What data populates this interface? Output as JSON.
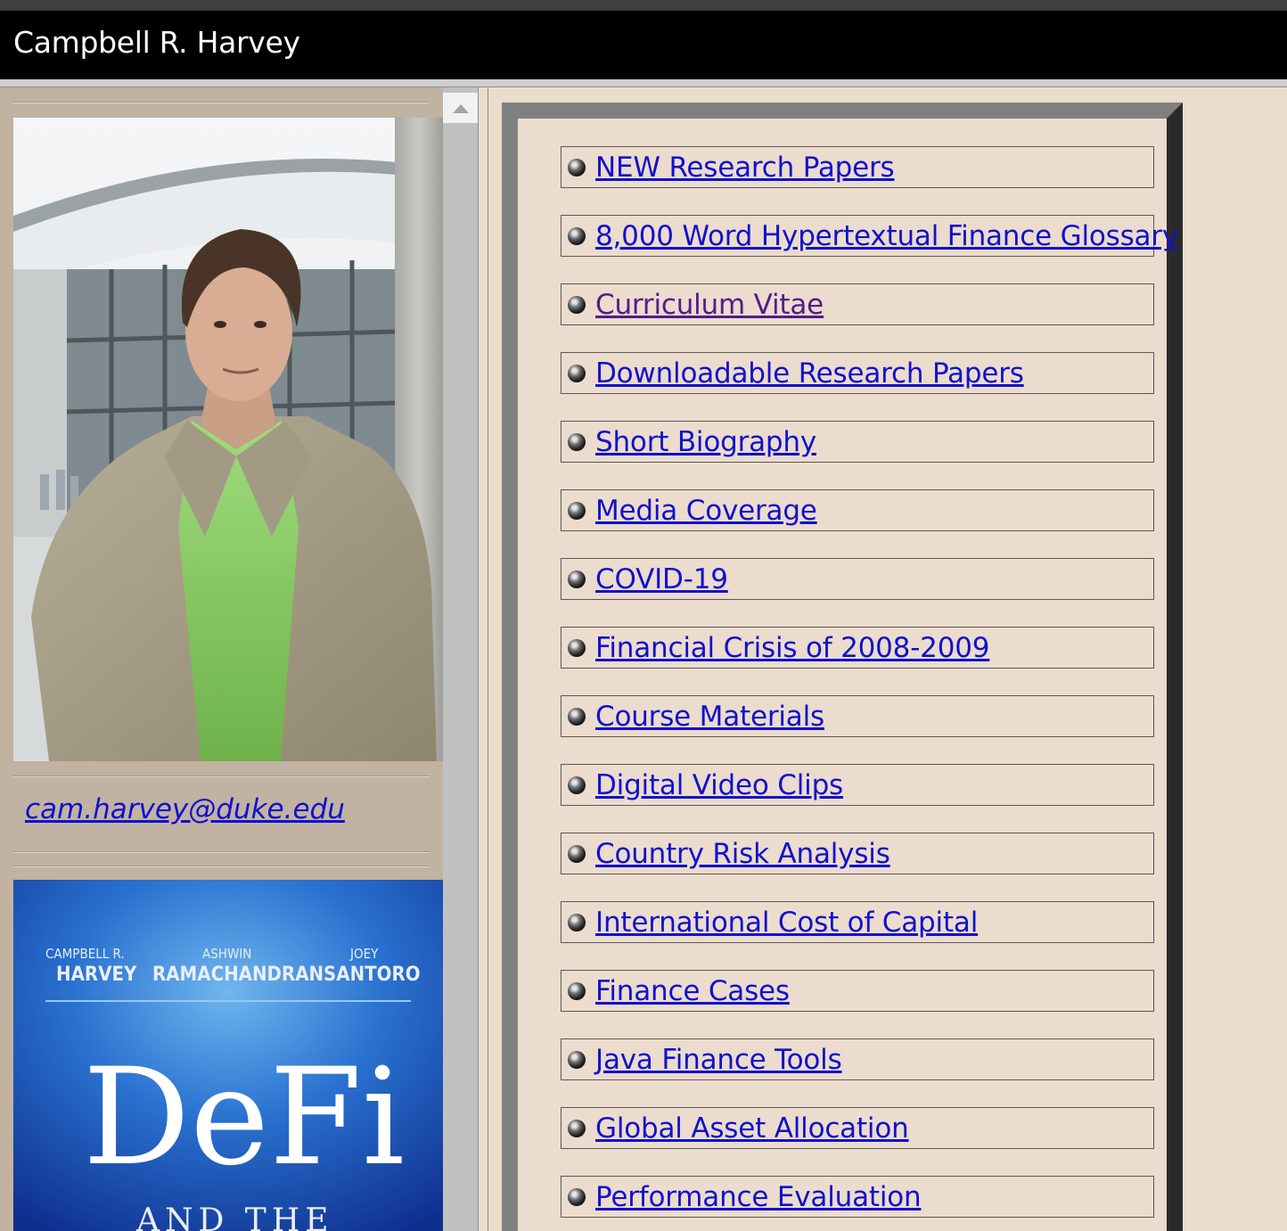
{
  "header": {
    "title": "Campbell R. Harvey"
  },
  "sidebar": {
    "photo_alt": "Portrait photo",
    "email": "cam.harvey@duke.edu",
    "book": {
      "authors": [
        {
          "first": "CAMPBELL R.",
          "last": "HARVEY"
        },
        {
          "first": "ASHWIN",
          "last": "RAMACHANDRAN"
        },
        {
          "first": "JOEY",
          "last": "SANTORO"
        }
      ],
      "title": "DeFi",
      "subtitle_fragment": "AND THE"
    }
  },
  "nav": {
    "links": [
      {
        "label": "NEW Research Papers",
        "visited": false
      },
      {
        "label": "8,000 Word Hypertextual Finance Glossary",
        "visited": false
      },
      {
        "label": "Curriculum Vitae",
        "visited": true
      },
      {
        "label": "Downloadable Research Papers",
        "visited": false
      },
      {
        "label": "Short Biography",
        "visited": false
      },
      {
        "label": "Media Coverage",
        "visited": false
      },
      {
        "label": "COVID-19",
        "visited": false
      },
      {
        "label": "Financial Crisis of 2008-2009",
        "visited": false
      },
      {
        "label": "Course Materials",
        "visited": false
      },
      {
        "label": "Digital Video Clips",
        "visited": false
      },
      {
        "label": "Country Risk Analysis",
        "visited": false
      },
      {
        "label": "International Cost of Capital",
        "visited": false
      },
      {
        "label": "Finance Cases",
        "visited": false
      },
      {
        "label": "Java Finance Tools",
        "visited": false
      },
      {
        "label": "Global Asset Allocation",
        "visited": false
      },
      {
        "label": "Performance Evaluation",
        "visited": false
      }
    ]
  },
  "colors": {
    "link": "#1111cc",
    "visited_link": "#551a8b",
    "page_bg": "#ebdccd",
    "sidebar_bg": "#c1b2a2",
    "header_bg": "#000000"
  },
  "icons": {
    "bullet": "sphere-bullet-icon",
    "scroll_up": "scroll-up-arrow-icon"
  }
}
